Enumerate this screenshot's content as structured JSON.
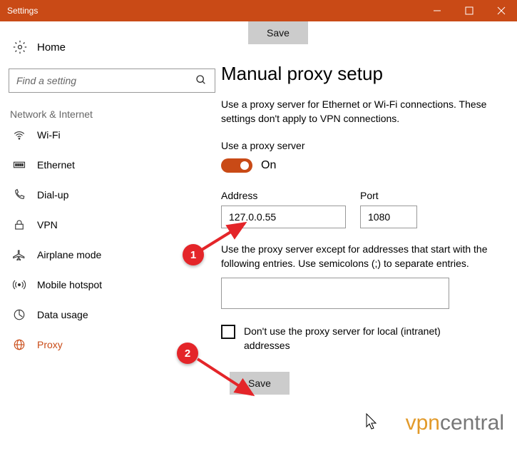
{
  "titlebar": {
    "title": "Settings"
  },
  "sidebar": {
    "home": "Home",
    "search_placeholder": "Find a setting",
    "group": "Network & Internet",
    "items": [
      {
        "label": "Wi-Fi"
      },
      {
        "label": "Ethernet"
      },
      {
        "label": "Dial-up"
      },
      {
        "label": "VPN"
      },
      {
        "label": "Airplane mode"
      },
      {
        "label": "Mobile hotspot"
      },
      {
        "label": "Data usage"
      },
      {
        "label": "Proxy"
      }
    ]
  },
  "main": {
    "save_top": "Save",
    "heading": "Manual proxy setup",
    "desc": "Use a proxy server for Ethernet or Wi-Fi connections. These settings don't apply to VPN connections.",
    "use_label": "Use a proxy server",
    "toggle_state": "On",
    "address_label": "Address",
    "address_value": "127.0.0.55",
    "port_label": "Port",
    "port_value": "1080",
    "except_text": "Use the proxy server except for addresses that start with the following entries. Use semicolons (;) to separate entries.",
    "checkbox_label": "Don't use the proxy server for local (intranet) addresses",
    "save_bottom": "Save"
  },
  "annotations": {
    "badge1": "1",
    "badge2": "2"
  },
  "watermark": {
    "part1": "vpn",
    "part2": "central"
  }
}
